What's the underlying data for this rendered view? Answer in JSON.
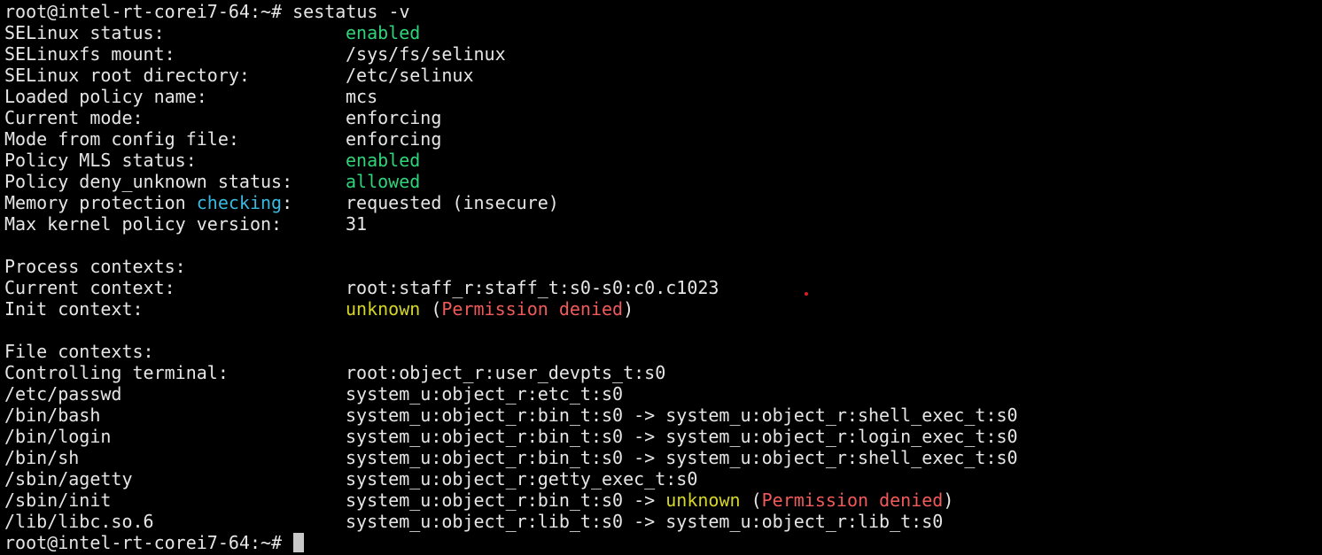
{
  "prompt": {
    "text": "root@intel-rt-corei7-64:~#",
    "command": "sestatus -v"
  },
  "status": {
    "selinux_status": {
      "key": "SELinux status:",
      "value": "enabled"
    },
    "selinuxfs_mount": {
      "key": "SELinuxfs mount:",
      "value": "/sys/fs/selinux"
    },
    "root_directory": {
      "key": "SELinux root directory:",
      "value": "/etc/selinux"
    },
    "policy_name": {
      "key": "Loaded policy name:",
      "value": "mcs"
    },
    "current_mode": {
      "key": "Current mode:",
      "value": "enforcing"
    },
    "config_mode": {
      "key": "Mode from config file:",
      "value": "enforcing"
    },
    "mls_status": {
      "key": "Policy MLS status:",
      "value": "enabled"
    },
    "deny_unknown": {
      "key": "Policy deny_unknown status:",
      "value": "allowed"
    },
    "memory_protection": {
      "key_pre": "Memory protection",
      "key_highlight": "checking",
      "key_post": ":",
      "value": "requested (insecure)"
    },
    "max_kernel_policy": {
      "key": "Max kernel policy version:",
      "value": "31"
    }
  },
  "process_contexts": {
    "heading": "Process contexts:",
    "current": {
      "key": "Current context:",
      "value": "root:staff_r:staff_t:s0-s0:c0.c1023"
    },
    "init": {
      "key": "Init context:",
      "value_unknown": "unknown",
      "paren_open": "(",
      "value_denied": "Permission denied",
      "paren_close": ")"
    }
  },
  "file_contexts": {
    "heading": "File contexts:",
    "controlling_terminal": {
      "key": "Controlling terminal:",
      "value": "root:object_r:user_devpts_t:s0"
    },
    "etc_passwd": {
      "key": "/etc/passwd",
      "value": "system_u:object_r:etc_t:s0"
    },
    "bin_bash": {
      "key": "/bin/bash",
      "value": "system_u:object_r:bin_t:s0 -> system_u:object_r:shell_exec_t:s0"
    },
    "bin_login": {
      "key": "/bin/login",
      "value": "system_u:object_r:bin_t:s0 -> system_u:object_r:login_exec_t:s0"
    },
    "bin_sh": {
      "key": "/bin/sh",
      "value": "system_u:object_r:bin_t:s0 -> system_u:object_r:shell_exec_t:s0"
    },
    "sbin_agetty": {
      "key": "/sbin/agetty",
      "value": "system_u:object_r:getty_exec_t:s0"
    },
    "sbin_init": {
      "key": "/sbin/init",
      "value_pre": "system_u:object_r:bin_t:s0 ->",
      "value_unknown": "unknown",
      "paren_open": "(",
      "value_denied": "Permission denied",
      "paren_close": ")"
    },
    "libc": {
      "key": "/lib/libc.so.6",
      "value": "system_u:object_r:lib_t:s0 -> system_u:object_r:lib_t:s0"
    }
  },
  "colors": {
    "background": "#000000",
    "foreground": "#e6e6e6",
    "enabled_green": "#2fd37a",
    "unknown_yellow": "#d6d62a",
    "denied_red": "#f05a5a",
    "highlight_cyan": "#3ab8e0"
  }
}
